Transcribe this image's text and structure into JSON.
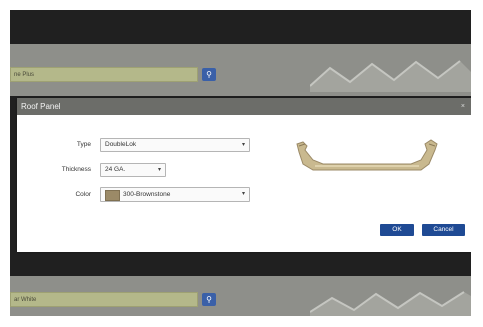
{
  "background": {
    "top_input_value": "ne Plus",
    "bottom_input_value": "ar White",
    "search_icon_glyph": "⚲"
  },
  "dialog": {
    "title": "Roof Panel",
    "close_glyph": "×",
    "type_label": "Type",
    "type_value": "DoubleLok",
    "thickness_label": "Thickness",
    "thickness_value": "24 GA.",
    "color_label": "Color",
    "color_value": "300-Brownstone",
    "dropdown_caret": "▾",
    "ok_label": "OK",
    "cancel_label": "Cancel"
  },
  "colors": {
    "dialog_title_bar": "#6c6d69",
    "primary_button": "#1f4a94",
    "brownstone_swatch": "#9b8a67",
    "panel_profile": "#c9b98f",
    "overlay_dark": "#202020",
    "background_band": "#8e8f8a"
  }
}
